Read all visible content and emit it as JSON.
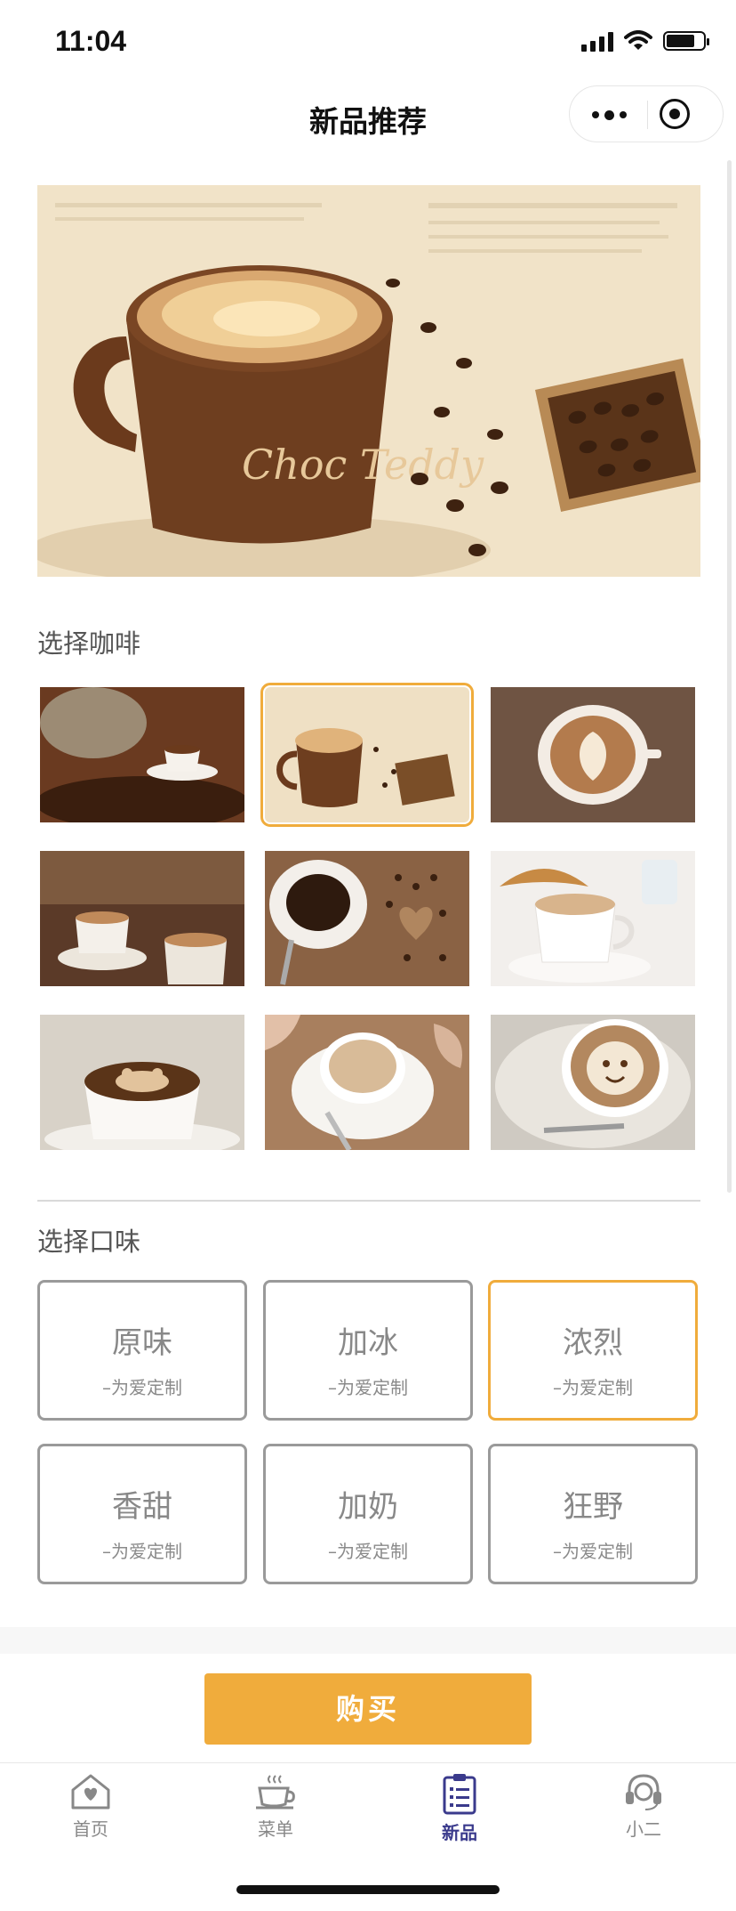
{
  "status_bar": {
    "time": "11:04"
  },
  "nav": {
    "title": "新品推荐"
  },
  "hero": {
    "cup_text": "Choc Teddy"
  },
  "coffee_section": {
    "title": "选择咖啡",
    "items": [
      {
        "name": "coffee-beans-sack",
        "selected": false
      },
      {
        "name": "choc-teddy-cup",
        "selected": true
      },
      {
        "name": "latte-art-heart",
        "selected": false
      },
      {
        "name": "two-cups-cafe",
        "selected": false
      },
      {
        "name": "espresso-heart-beans",
        "selected": false
      },
      {
        "name": "cocoa-croissant",
        "selected": false
      },
      {
        "name": "bear-latte-art",
        "selected": false
      },
      {
        "name": "cappuccino-shells",
        "selected": false
      },
      {
        "name": "face-latte-art",
        "selected": false
      }
    ]
  },
  "flavor_section": {
    "title": "选择口味",
    "items": [
      {
        "name": "原味",
        "sub": "–为爱定制",
        "selected": false
      },
      {
        "name": "加冰",
        "sub": "–为爱定制",
        "selected": false
      },
      {
        "name": "浓烈",
        "sub": "–为爱定制",
        "selected": true
      },
      {
        "name": "香甜",
        "sub": "–为爱定制",
        "selected": false
      },
      {
        "name": "加奶",
        "sub": "–为爱定制",
        "selected": false
      },
      {
        "name": "狂野",
        "sub": "–为爱定制",
        "selected": false
      }
    ]
  },
  "buy_button": {
    "label": "购买"
  },
  "tabbar": {
    "items": [
      {
        "label": "首页",
        "icon": "home-heart-icon",
        "active": false
      },
      {
        "label": "菜单",
        "icon": "coffee-cup-icon",
        "active": false
      },
      {
        "label": "新品",
        "icon": "clipboard-list-icon",
        "active": true
      },
      {
        "label": "小二",
        "icon": "headset-icon",
        "active": false
      }
    ]
  },
  "colors": {
    "accent": "#f0ac3c",
    "tab_active": "#3a3a8c",
    "border": "#9a9a9a"
  }
}
